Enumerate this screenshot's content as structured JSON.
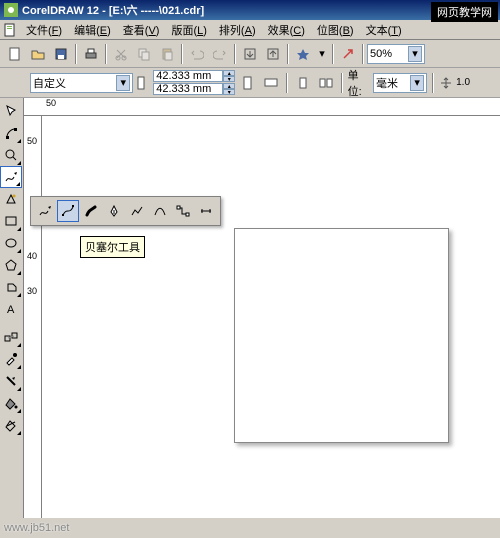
{
  "titlebar": {
    "app": "CorelDRAW 12",
    "file": "[E:\\六  -----\\021.cdr]"
  },
  "menubar": {
    "items": [
      {
        "label": "文件",
        "key": "F"
      },
      {
        "label": "编辑",
        "key": "E"
      },
      {
        "label": "查看",
        "key": "V"
      },
      {
        "label": "版面",
        "key": "L"
      },
      {
        "label": "排列",
        "key": "A"
      },
      {
        "label": "效果",
        "key": "C"
      },
      {
        "label": "位图",
        "key": "B"
      },
      {
        "label": "文本",
        "key": "T"
      }
    ]
  },
  "toolbar": {
    "zoom": "50%"
  },
  "propbar": {
    "paper": "自定义",
    "width": "42.333 mm",
    "height": "42.333 mm",
    "unit_label": "单位:",
    "unit": "毫米",
    "nudge": "1.0"
  },
  "ruler": {
    "h_ticks": [
      "50"
    ],
    "v_ticks": [
      "50",
      "40",
      "30"
    ]
  },
  "flyout": {
    "tooltip": "贝塞尔工具"
  },
  "watermarks": {
    "top_right": "网页教学网",
    "bottom_left": "www.jb51.net"
  },
  "colors": {
    "titlebar_start": "#0a246a",
    "titlebar_end": "#3a6ea5",
    "face": "#d4d0c8",
    "highlight": "#316ac5"
  }
}
